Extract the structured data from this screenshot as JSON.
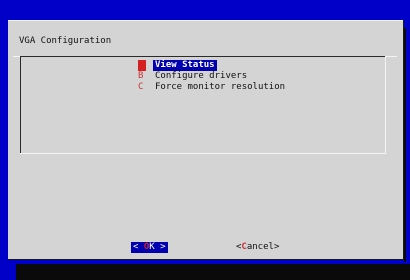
{
  "dialog": {
    "title": "VGA Configuration"
  },
  "menu": {
    "items": [
      {
        "tag": "A",
        "label": "View Status",
        "selected": true
      },
      {
        "tag": "B",
        "label": "Configure drivers",
        "selected": false
      },
      {
        "tag": "C",
        "label": "Force monitor resolution",
        "selected": false
      }
    ]
  },
  "buttons": {
    "ok": {
      "left": "< ",
      "hot": "O",
      "rest": "K",
      "right": " >"
    },
    "cancel": {
      "left": "<",
      "hot": "C",
      "rest": "ancel",
      "right": ">"
    }
  },
  "colors": {
    "background": "#0000c8",
    "dialog": "#d4d4d4",
    "highlight": "#0000b0",
    "hotkey": "#d42020"
  }
}
